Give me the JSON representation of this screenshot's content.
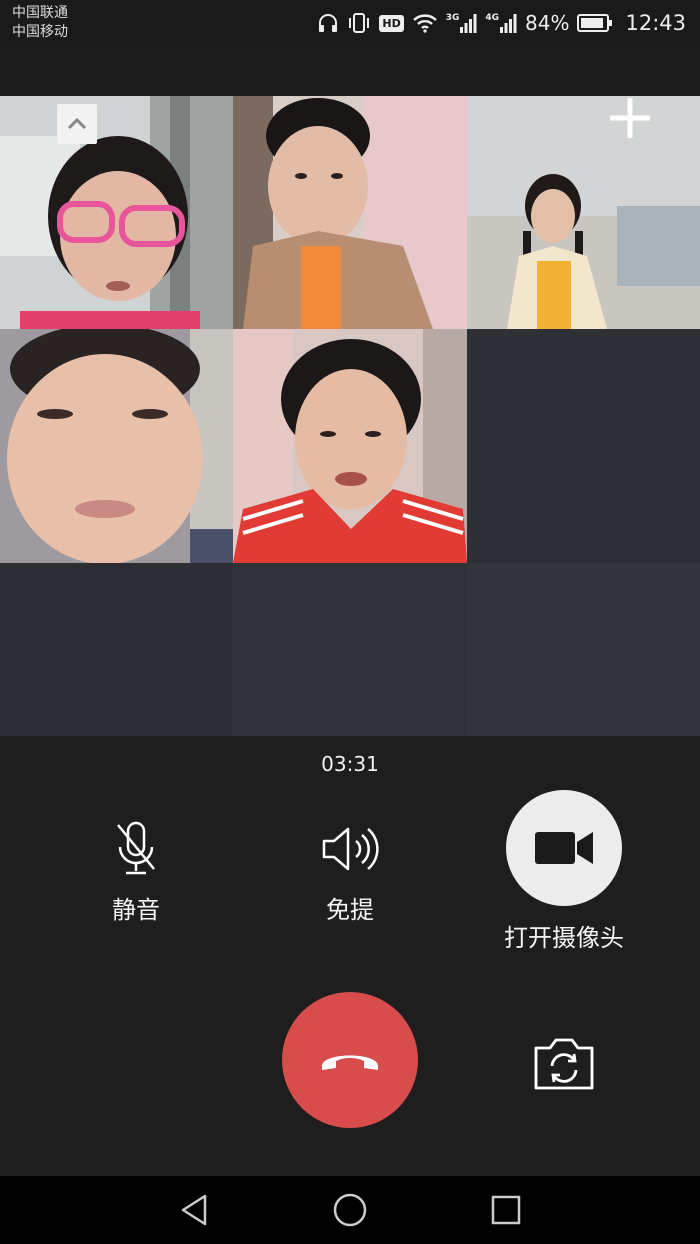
{
  "status_bar": {
    "carrier_1": "中国联通",
    "carrier_2": "中国移动",
    "hd_badge": "HD",
    "network_1": "3G",
    "network_2": "4G",
    "battery_percent": "84%",
    "time": "12:43",
    "icons": [
      "headphones-icon",
      "vibrate-icon",
      "hd-icon",
      "wifi-icon",
      "signal-icon",
      "battery-icon"
    ]
  },
  "call": {
    "duration": "03:31",
    "participants_count_visible": 5
  },
  "controls": {
    "mute_label": "静音",
    "speaker_label": "免提",
    "camera_label": "打开摄像头",
    "icons": [
      "mic-muted-icon",
      "speaker-icon",
      "video-camera-icon",
      "hang-up-icon",
      "switch-camera-icon"
    ]
  },
  "colors": {
    "hangup": "#d94c4c",
    "camera_button_bg": "#ececec",
    "background": "#1e1e1e",
    "empty_tile": "#2f3035"
  }
}
